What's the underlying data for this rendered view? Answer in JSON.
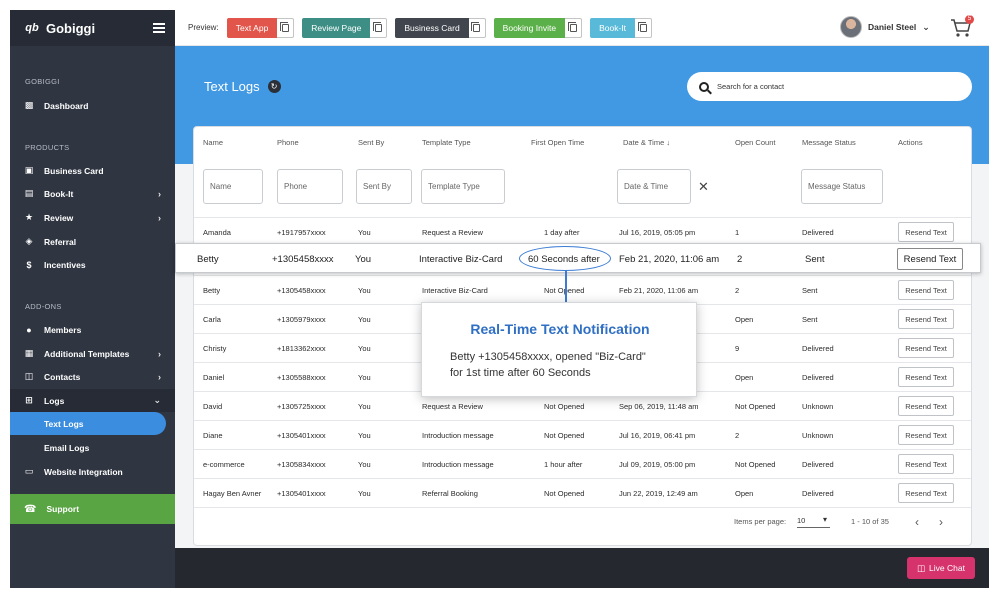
{
  "brand": {
    "name": "Gobiggi",
    "logo_mark": "qb"
  },
  "sidebar": {
    "sections": [
      "GOBIGGI",
      "PRODUCTS",
      "ADD-ONS"
    ],
    "items": [
      {
        "label": "Dashboard",
        "icon": "dashboard-icon"
      },
      {
        "label": "Business Card",
        "icon": "business-card-icon"
      },
      {
        "label": "Book-It",
        "icon": "book-icon"
      },
      {
        "label": "Review",
        "icon": "star-icon"
      },
      {
        "label": "Referral",
        "icon": "tag-icon"
      },
      {
        "label": "Incentives",
        "icon": "dollar-icon"
      },
      {
        "label": "Members",
        "icon": "members-icon"
      },
      {
        "label": "Additional Templates",
        "icon": "templates-icon"
      },
      {
        "label": "Contacts",
        "icon": "contacts-icon"
      },
      {
        "label": "Logs",
        "icon": "logs-icon"
      },
      {
        "label": "Text Logs",
        "icon": ""
      },
      {
        "label": "Email Logs",
        "icon": ""
      },
      {
        "label": "Website Integration",
        "icon": "website-icon"
      }
    ],
    "support": "Support"
  },
  "topbar": {
    "preview_label": "Preview:",
    "preview_buttons": [
      {
        "label": "Text App",
        "color": "#e2554a"
      },
      {
        "label": "Review Page",
        "color": "#3d8f86"
      },
      {
        "label": "Business Card",
        "color": "#40454e"
      },
      {
        "label": "Booking Invite",
        "color": "#5cb04a"
      },
      {
        "label": "Book-It",
        "color": "#58b9d9"
      }
    ],
    "user_name": "Daniel Steel",
    "cart_count": "5"
  },
  "page": {
    "title": "Text Logs",
    "search_placeholder": "Search for a contact"
  },
  "table": {
    "headers": [
      "Name",
      "Phone",
      "Sent By",
      "Template Type",
      "First Open Time",
      "Date & Time",
      "Open Count",
      "Message Status",
      "Actions"
    ],
    "filters": [
      "Name",
      "Phone",
      "Sent By",
      "Template Type",
      "Date & Time",
      "Message Status"
    ],
    "resend_label": "Resend Text",
    "rows": [
      [
        "Amanda",
        "+1917957xxxx",
        "You",
        "Request a Review",
        "1 day after",
        "Jul 16, 2019, 05:05 pm",
        "1",
        "Delivered"
      ],
      [
        "Betty",
        "+1305458xxxx",
        "You",
        "Interactive Biz-Card",
        "Not Opened",
        "Feb 21, 2020, 11:06 am",
        "2",
        "Sent"
      ],
      [
        "Carla",
        "+1305979xxxx",
        "You",
        "",
        "",
        "",
        "Open",
        "Sent"
      ],
      [
        "Christy",
        "+1813362xxxx",
        "You",
        "",
        "",
        "",
        "9",
        "Delivered"
      ],
      [
        "Daniel",
        "+1305588xxxx",
        "You",
        "",
        "",
        "",
        "Open",
        "Delivered"
      ],
      [
        "David",
        "+1305725xxxx",
        "You",
        "Request a Review",
        "Not Opened",
        "Sep 06, 2019, 11:48 am",
        "Not Opened",
        "Unknown"
      ],
      [
        "Diane",
        "+1305401xxxx",
        "You",
        "Introduction message",
        "Not Opened",
        "Jul 16, 2019, 06:41 pm",
        "2",
        "Unknown"
      ],
      [
        "e-commerce",
        "+1305834xxxx",
        "You",
        "Introduction message",
        "1 hour after",
        "Jul 09, 2019, 05:00 pm",
        "Not Opened",
        "Delivered"
      ],
      [
        "Hagay Ben Avner",
        "+1305401xxxx",
        "You",
        "Referral Booking",
        "Not Opened",
        "Jun 22, 2019, 12:49 am",
        "Open",
        "Delivered"
      ]
    ],
    "highlight_row": [
      "Betty",
      "+1305458xxxx",
      "You",
      "Interactive Biz-Card",
      "60 Seconds after",
      "Feb 21, 2020, 11:06 am",
      "2",
      "Sent"
    ]
  },
  "callout": {
    "title": "Real-Time Text Notification",
    "line1": "Betty +1305458xxxx, opened \"Biz-Card\"",
    "line2": "for 1st time after 60 Seconds"
  },
  "pagination": {
    "items_per_page_label": "Items per page:",
    "per_page": "10",
    "range": "1 - 10 of 35"
  },
  "footer": {
    "live_chat": "Live Chat"
  }
}
